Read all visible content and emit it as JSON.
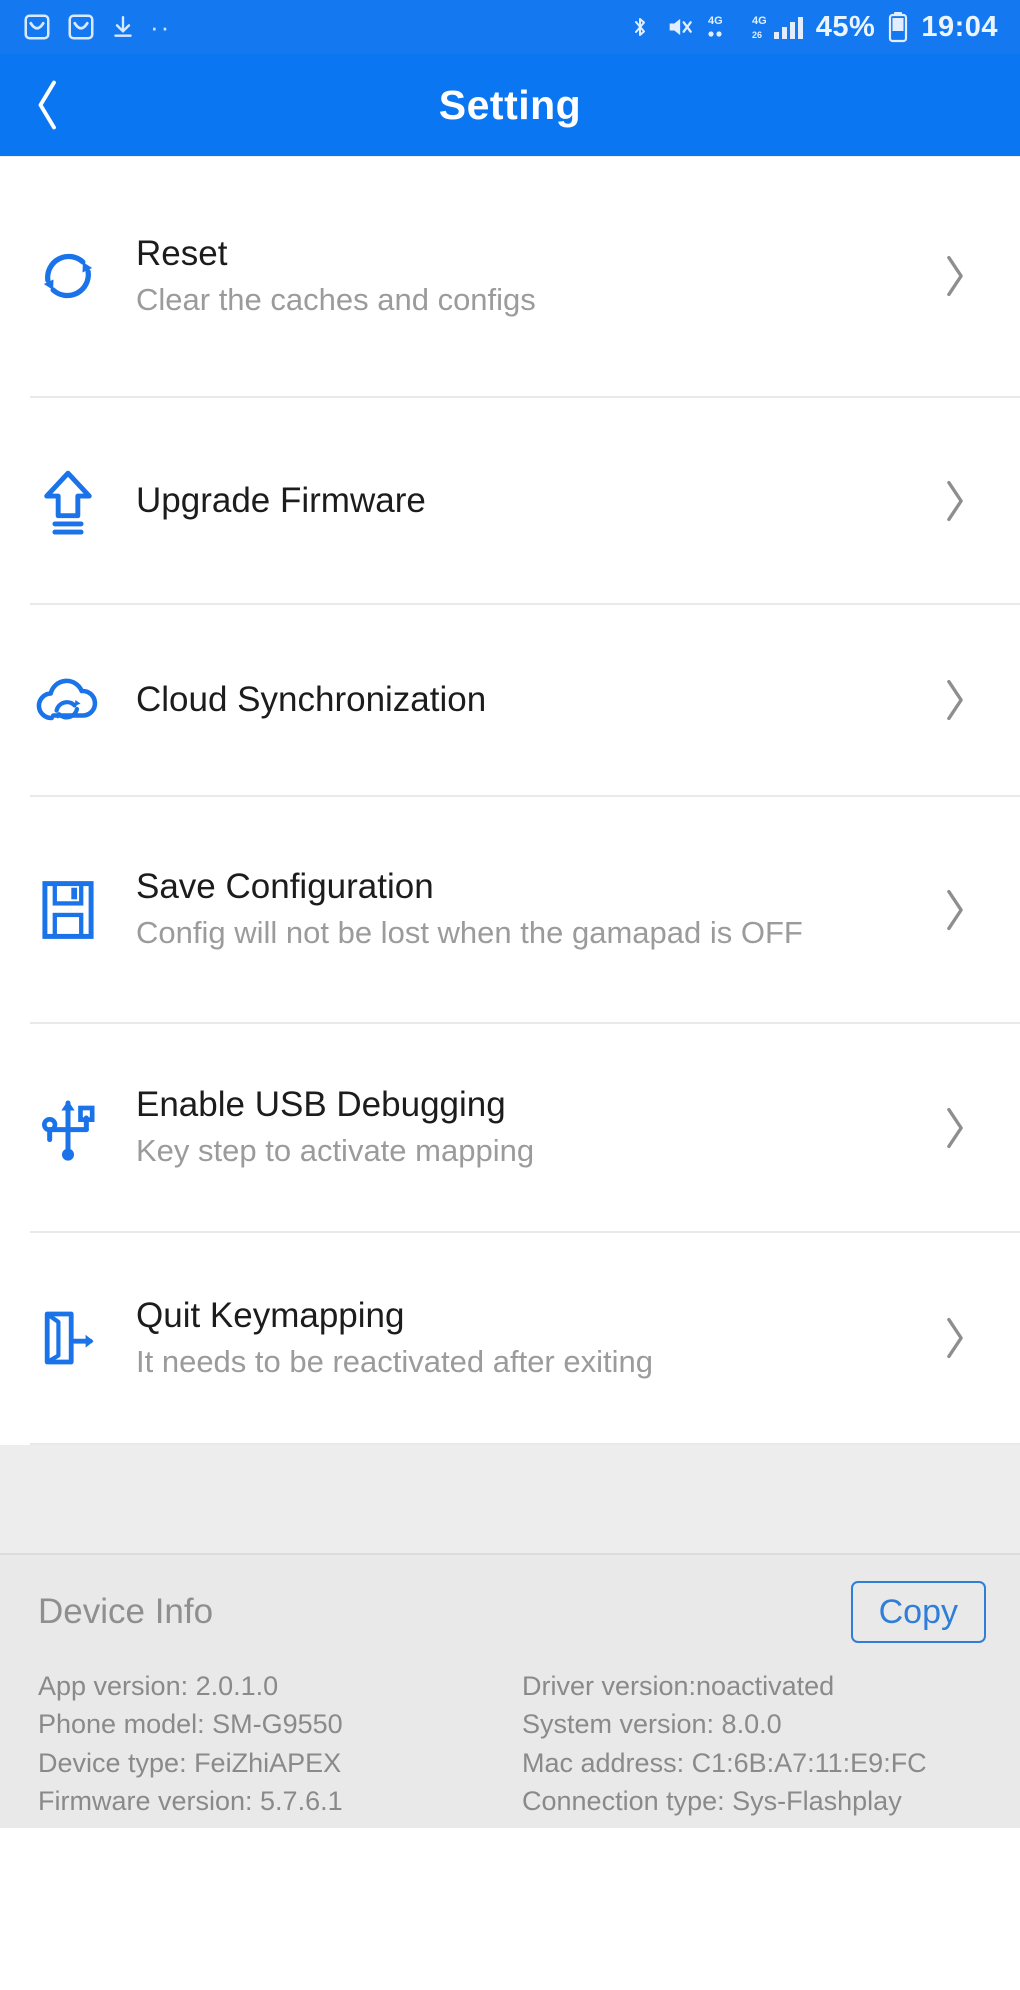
{
  "status_bar": {
    "left_icons": [
      "mail-icon",
      "mail-icon",
      "download-icon",
      "more-dots-icon"
    ],
    "right_icons": [
      "bluetooth-icon",
      "mute-icon",
      "signal-4g-icon",
      "signal-4g-bars-icon",
      "battery-icon"
    ],
    "battery_percent": "45%",
    "time": "19:04",
    "network_label_1": "4G",
    "network_label_2": "4G",
    "background_color": "#1479f0"
  },
  "app_bar": {
    "title": "Setting",
    "back_icon": "chevron-left-icon",
    "background_color": "#0b76f2"
  },
  "settings": {
    "items": [
      {
        "id": "reset",
        "title": "Reset",
        "subtitle": "Clear the caches and configs",
        "icon": "refresh-circle-icon",
        "chevron": "chevron-right-icon"
      },
      {
        "id": "upgrade-firmware",
        "title": "Upgrade Firmware",
        "subtitle": "",
        "icon": "upload-arrow-icon",
        "chevron": "chevron-right-icon"
      },
      {
        "id": "cloud-synchronization",
        "title": "Cloud Synchronization",
        "subtitle": "",
        "icon": "cloud-sync-icon",
        "chevron": "chevron-right-icon"
      },
      {
        "id": "save-configuration",
        "title": "Save Configuration",
        "subtitle": "Config will not be lost when the gamapad is OFF",
        "icon": "floppy-disk-icon",
        "chevron": "chevron-right-icon"
      },
      {
        "id": "enable-usb-debugging",
        "title": "Enable USB Debugging",
        "subtitle": "Key step to activate mapping",
        "icon": "usb-icon",
        "chevron": "chevron-right-icon"
      },
      {
        "id": "quit-keymapping",
        "title": "Quit Keymapping",
        "subtitle": "It needs to be reactivated after exiting",
        "icon": "exit-door-icon",
        "chevron": "chevron-right-icon"
      }
    ],
    "accent_color": "#1a73e8"
  },
  "device_info": {
    "label": "Device Info",
    "copy_label": "Copy",
    "left_column": [
      "App version: 2.0.1.0",
      "Phone model: SM-G9550",
      "Device type: FeiZhiAPEX",
      "Firmware version: 5.7.6.1"
    ],
    "right_column": [
      "Driver version:noactivated",
      "System version: 8.0.0",
      "Mac address: C1:6B:A7:11:E9:FC",
      "Connection type: Sys-Flashplay"
    ]
  }
}
